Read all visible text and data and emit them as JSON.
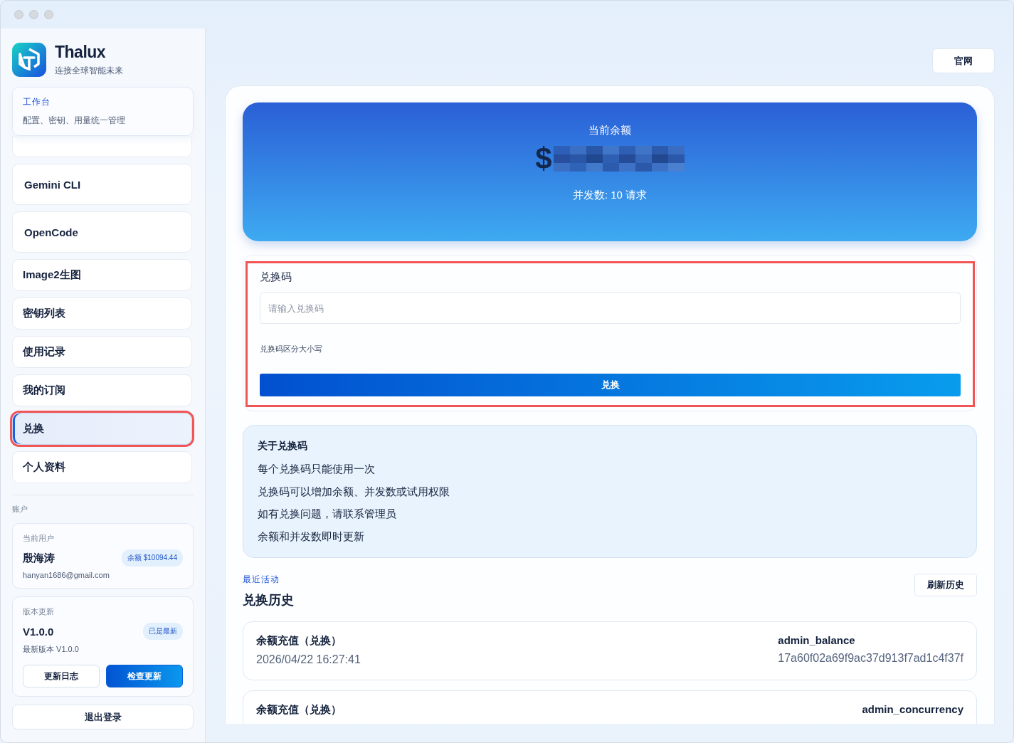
{
  "brand": {
    "name": "Thalux",
    "tagline": "连接全球智能未来"
  },
  "workspace": {
    "title": "工作台",
    "subtitle": "配置、密钥、用量统一管理"
  },
  "nav": [
    {
      "label": "Gemini CLI",
      "kind": "tool",
      "selected": false
    },
    {
      "label": "OpenCode",
      "kind": "tool",
      "selected": false
    },
    {
      "label": "Image2生图",
      "kind": "page",
      "selected": false
    },
    {
      "label": "密钥列表",
      "kind": "page",
      "selected": false
    },
    {
      "label": "使用记录",
      "kind": "page",
      "selected": false
    },
    {
      "label": "我的订阅",
      "kind": "page",
      "selected": false
    },
    {
      "label": "兑换",
      "kind": "page",
      "selected": true
    },
    {
      "label": "个人资料",
      "kind": "page",
      "selected": false
    }
  ],
  "account": {
    "section": "账户",
    "caption": "当前用户",
    "name": "殷海涛",
    "balance_badge": "余额 $10094.44",
    "email": "hanyan1686@gmail.com"
  },
  "version": {
    "caption": "版本更新",
    "current": "V1.0.0",
    "badge": "已是最新",
    "latest": "最新版本 V1.0.0",
    "buttons": [
      "更新日志",
      "检查更新"
    ]
  },
  "logout": "退出登录",
  "website_button": "官网",
  "balance": {
    "title": "当前余额",
    "currency": "$",
    "concurrency": "并发数: 10 请求"
  },
  "redeem": {
    "label": "兑换码",
    "placeholder": "请输入兑换码",
    "hint": "兑换码区分大小写",
    "button": "兑换"
  },
  "about": {
    "title": "关于兑换码",
    "lines": [
      "每个兑换码只能使用一次",
      "兑换码可以增加余额、并发数或试用权限",
      "如有兑换问题，请联系管理员",
      "余额和并发数即时更新"
    ]
  },
  "history": {
    "eyebrow": "最近活动",
    "title": "兑换历史",
    "refresh": "刷新历史",
    "items": [
      {
        "type": "余额充值（兑换）",
        "time": "2026/04/22 16:27:41",
        "source": "admin_balance",
        "code": "17a60f02a69f9ac37d913f7ad1c4f37f"
      },
      {
        "type": "余额充值（兑换）",
        "source": "admin_concurrency"
      }
    ]
  }
}
